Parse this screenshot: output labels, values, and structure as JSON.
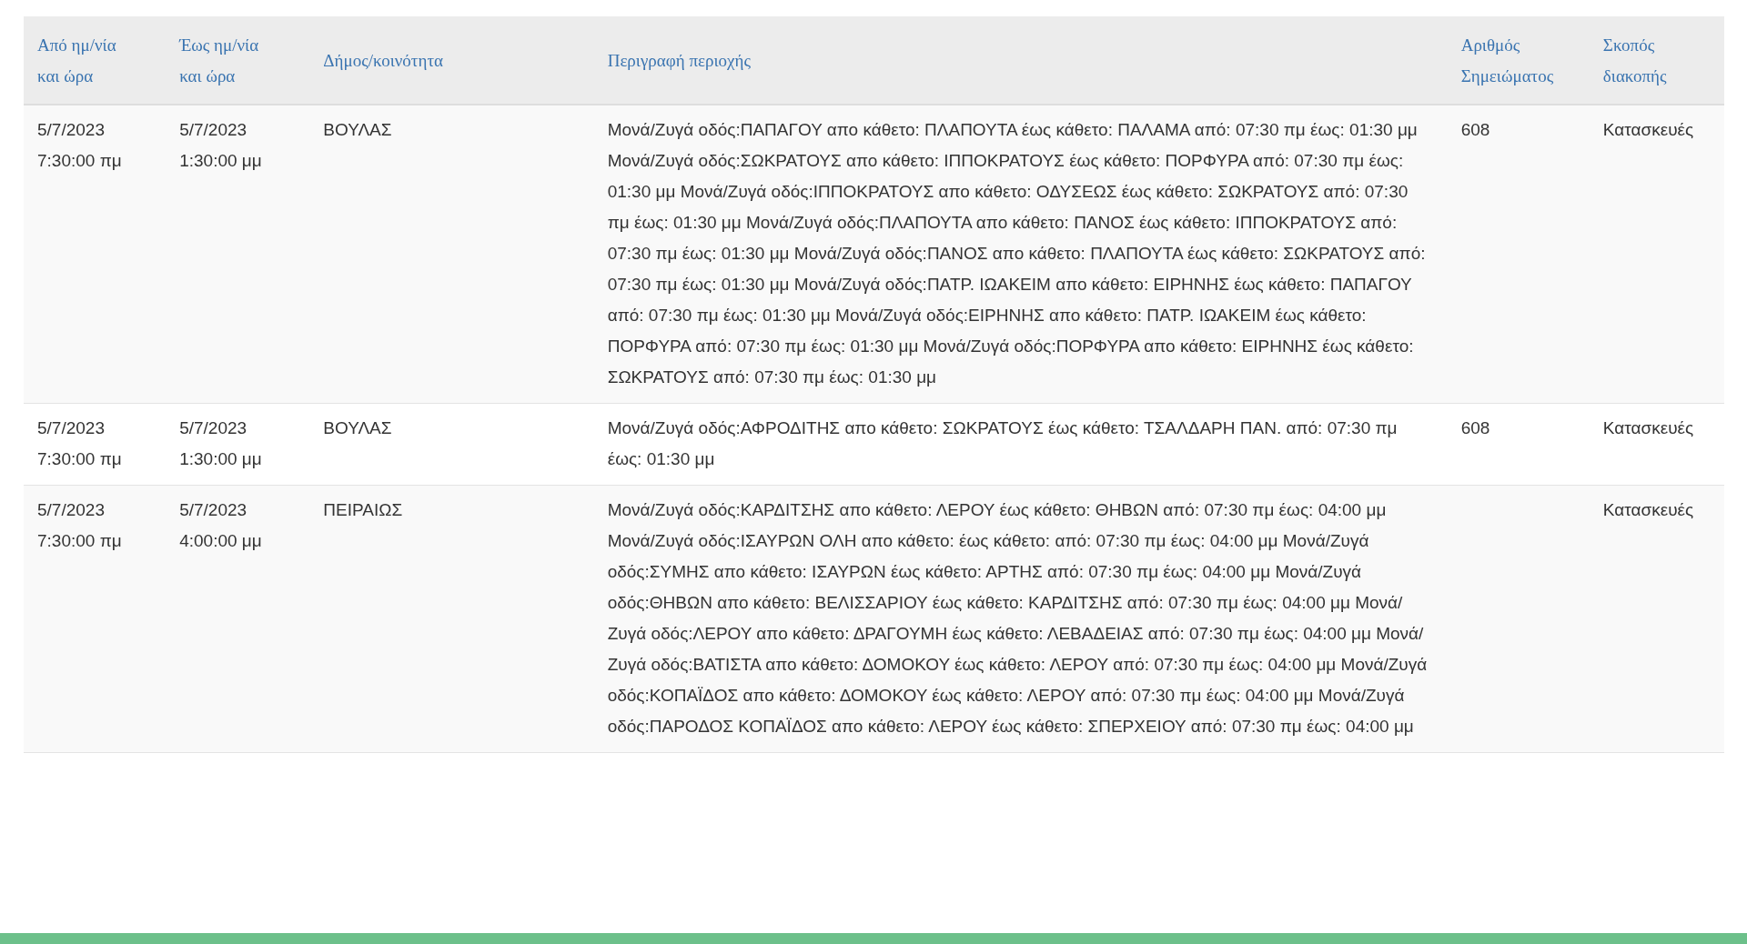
{
  "table": {
    "columns": [
      "Από ημ/νία και ώρα",
      "Έως ημ/νία και ώρα",
      "Δήμος/κοινότητα",
      "Περιγραφή περιοχής",
      "Αριθμός Σημειώματος",
      "Σκοπός διακοπής"
    ],
    "rows": [
      {
        "from": "5/7/2023 7:30:00 πμ",
        "to": "5/7/2023 1:30:00 μμ",
        "municipality": "ΒΟΥΛΑΣ",
        "description": "Μονά/Ζυγά οδός:ΠΑΠΑΓΟΥ απο κάθετο: ΠΛΑΠΟΥΤΑ έως κάθετο: ΠΑΛΑΜΑ από: 07:30 πμ έως: 01:30 μμ Μονά/Ζυγά οδός:ΣΩΚΡΑΤΟΥΣ απο κάθετο: ΙΠΠΟΚΡΑΤΟΥΣ έως κάθετο: ΠΟΡΦΥΡΑ από: 07:30 πμ έως: 01:30 μμ Μονά/Ζυγά οδός:ΙΠΠΟΚΡΑΤΟΥΣ απο κάθετο: ΟΔΥΣΕΩΣ έως κάθετο: ΣΩΚΡΑΤΟΥΣ από: 07:30 πμ έως: 01:30 μμ Μονά/Ζυγά οδός:ΠΛΑΠΟΥΤΑ απο κάθετο: ΠΑΝΟΣ έως κάθετο: ΙΠΠΟΚΡΑΤΟΥΣ από: 07:30 πμ έως: 01:30 μμ Μονά/Ζυγά οδός:ΠΑΝΟΣ απο κάθετο: ΠΛΑΠΟΥΤΑ έως κάθετο: ΣΩΚΡΑΤΟΥΣ από: 07:30 πμ έως: 01:30 μμ Μονά/Ζυγά οδός:ΠΑΤΡ. ΙΩΑΚΕΙΜ απο κάθετο: ΕΙΡΗΝΗΣ έως κάθετο: ΠΑΠΑΓΟΥ από: 07:30 πμ έως: 01:30 μμ Μονά/Ζυγά οδός:ΕΙΡΗΝΗΣ απο κάθετο: ΠΑΤΡ. ΙΩΑΚΕΙΜ έως κάθετο: ΠΟΡΦΥΡΑ από: 07:30 πμ έως: 01:30 μμ Μονά/Ζυγά οδός:ΠΟΡΦΥΡΑ απο κάθετο: ΕΙΡΗΝΗΣ έως κάθετο: ΣΩΚΡΑΤΟΥΣ από: 07:30 πμ έως: 01:30 μμ",
        "notice_number": "608",
        "purpose": "Κατασκευές"
      },
      {
        "from": "5/7/2023 7:30:00 πμ",
        "to": "5/7/2023 1:30:00 μμ",
        "municipality": "ΒΟΥΛΑΣ",
        "description": "Μονά/Ζυγά οδός:ΑΦΡΟΔΙΤΗΣ απο κάθετο: ΣΩΚΡΑΤΟΥΣ έως κάθετο: ΤΣΑΛΔΑΡΗ ΠΑΝ. από: 07:30 πμ έως: 01:30 μμ",
        "notice_number": "608",
        "purpose": "Κατασκευές"
      },
      {
        "from": "5/7/2023 7:30:00 πμ",
        "to": "5/7/2023 4:00:00 μμ",
        "municipality": "ΠΕΙΡΑΙΩΣ",
        "description": "Μονά/Ζυγά οδός:ΚΑΡΔΙΤΣΗΣ απο κάθετο: ΛΕΡΟΥ έως κάθετο: ΘΗΒΩΝ από: 07:30 πμ έως: 04:00 μμ Μονά/Ζυγά οδός:ΙΣΑΥΡΩΝ ΟΛΗ απο κάθετο: έως κάθετο: από: 07:30 πμ έως: 04:00 μμ Μονά/Ζυγά οδός:ΣΥΜΗΣ απο κάθετο: ΙΣΑΥΡΩΝ έως κάθετο: ΑΡΤΗΣ από: 07:30 πμ έως: 04:00 μμ Μονά/Ζυγά οδός:ΘΗΒΩΝ απο κάθετο: ΒΕΛΙΣΣΑΡΙΟΥ έως κάθετο: ΚΑΡΔΙΤΣΗΣ από: 07:30 πμ έως: 04:00 μμ Μονά/Ζυγά οδός:ΛΕΡΟΥ απο κάθετο: ΔΡΑΓΟΥΜΗ έως κάθετο: ΛΕΒΑΔΕΙΑΣ από: 07:30 πμ έως: 04:00 μμ Μονά/Ζυγά οδός:ΒΑΤΙΣΤΑ απο κάθετο: ΔΟΜΟΚΟΥ έως κάθετο: ΛΕΡΟΥ από: 07:30 πμ έως: 04:00 μμ Μονά/Ζυγά οδός:ΚΟΠΑΪΔΟΣ απο κάθετο: ΔΟΜΟΚΟΥ έως κάθετο: ΛΕΡΟΥ από: 07:30 πμ έως: 04:00 μμ Μονά/Ζυγά οδός:ΠΑΡΟΔΟΣ ΚΟΠΑΪΔΟΣ απο κάθετο: ΛΕΡΟΥ έως κάθετο: ΣΠΕΡΧΕΙΟΥ από: 07:30 πμ έως: 04:00 μμ",
        "purpose": "Κατασκευές"
      }
    ]
  }
}
